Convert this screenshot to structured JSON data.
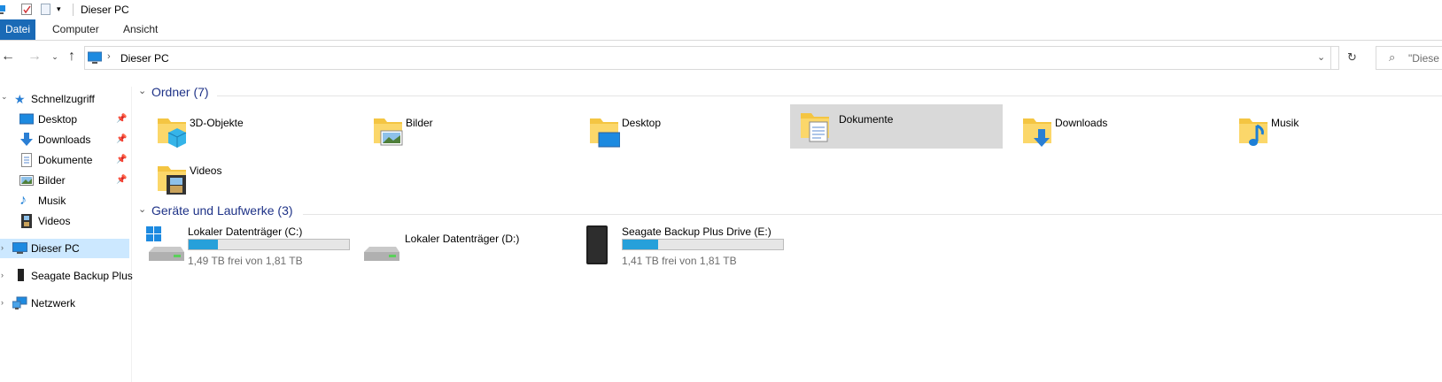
{
  "window": {
    "title": "Dieser PC"
  },
  "ribbon": {
    "tabs": [
      "Datei",
      "Computer",
      "Ansicht"
    ]
  },
  "address": {
    "location": "Dieser PC",
    "search_placeholder": "\"Diese"
  },
  "sidebar": {
    "items": [
      {
        "label": "Schnellzugriff",
        "icon": "star-icon",
        "pinned": false
      },
      {
        "label": "Desktop",
        "icon": "desktop-icon",
        "pinned": true
      },
      {
        "label": "Downloads",
        "icon": "download-arrow-icon",
        "pinned": true
      },
      {
        "label": "Dokumente",
        "icon": "document-icon",
        "pinned": true
      },
      {
        "label": "Bilder",
        "icon": "picture-icon",
        "pinned": true
      },
      {
        "label": "Musik",
        "icon": "music-note-icon",
        "pinned": false
      },
      {
        "label": "Videos",
        "icon": "film-icon",
        "pinned": false
      },
      {
        "label": "Dieser PC",
        "icon": "computer-icon",
        "pinned": false
      },
      {
        "label": "Seagate Backup Plus",
        "icon": "external-drive-icon",
        "pinned": false
      },
      {
        "label": "Netzwerk",
        "icon": "network-icon",
        "pinned": false
      }
    ]
  },
  "folders": {
    "header": "Ordner (7)",
    "items": [
      {
        "label": "3D-Objekte",
        "icon": "3d-objects-folder-icon"
      },
      {
        "label": "Bilder",
        "icon": "pictures-folder-icon"
      },
      {
        "label": "Desktop",
        "icon": "desktop-folder-icon"
      },
      {
        "label": "Dokumente",
        "icon": "documents-folder-icon"
      },
      {
        "label": "Downloads",
        "icon": "downloads-folder-icon"
      },
      {
        "label": "Musik",
        "icon": "music-folder-icon"
      },
      {
        "label": "Videos",
        "icon": "videos-folder-icon"
      }
    ]
  },
  "drives": {
    "header": "Geräte und Laufwerke (3)",
    "items": [
      {
        "label": "Lokaler Datenträger (C:)",
        "free": "1,49 TB frei von 1,81 TB",
        "used_fraction": 0.18,
        "icon": "windows-drive-icon"
      },
      {
        "label": "Lokaler Datenträger (D:)",
        "free": "",
        "used_fraction": null,
        "icon": "hard-drive-icon"
      },
      {
        "label": "Seagate Backup Plus Drive (E:)",
        "free": "1,41 TB frei von 1,81 TB",
        "used_fraction": 0.22,
        "icon": "external-drive-icon"
      }
    ]
  },
  "colors": {
    "accent": "#1a6ab6",
    "header_text": "#1e3287",
    "bar_fill": "#26a0da",
    "selection": "#cce8ff",
    "hover": "#d9d9d9"
  }
}
